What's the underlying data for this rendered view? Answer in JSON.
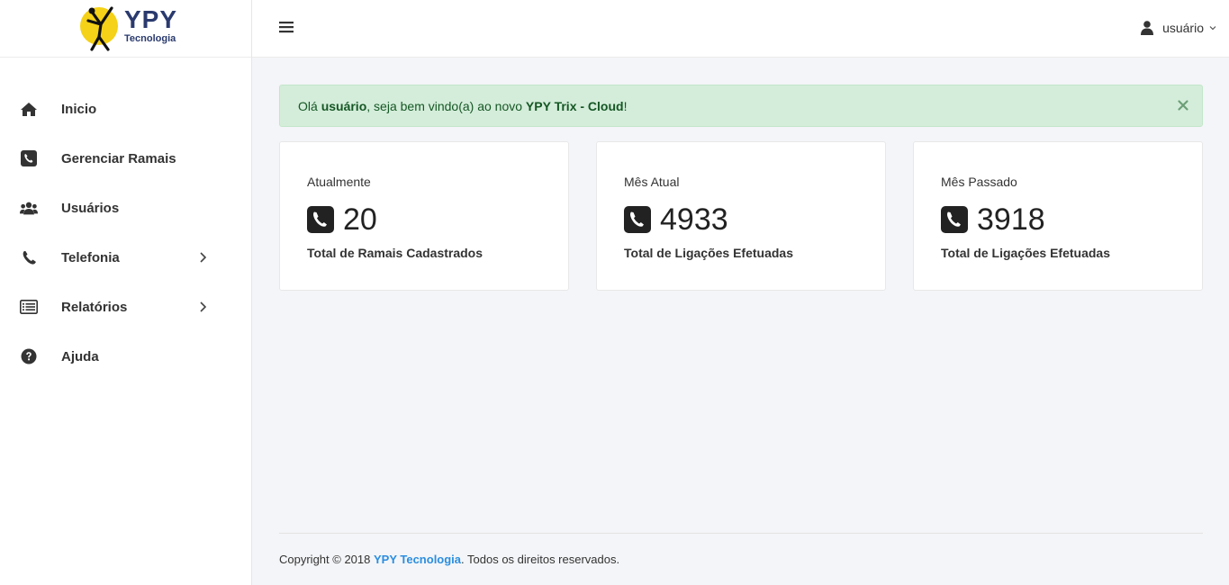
{
  "brand": {
    "name": "YPY",
    "subtitle": "Tecnologia"
  },
  "colors": {
    "accent": "#2b8ee0",
    "alert_bg": "#d4edda",
    "alert_text": "#155724",
    "logo_sun": "#f5d117",
    "logo_text": "#2a3a6e"
  },
  "sidebar": {
    "items": [
      {
        "label": "Inicio",
        "icon": "home-icon"
      },
      {
        "label": "Gerenciar Ramais",
        "icon": "phone-square-icon"
      },
      {
        "label": "Usuários",
        "icon": "users-icon"
      },
      {
        "label": "Telefonia",
        "icon": "phone-icon",
        "submenu": true
      },
      {
        "label": "Relatórios",
        "icon": "list-icon",
        "submenu": true
      },
      {
        "label": "Ajuda",
        "icon": "question-circle-icon"
      }
    ]
  },
  "topbar": {
    "menu_icon": "hamburger-icon",
    "user_name": "usuário"
  },
  "alert": {
    "greeting": "Olá ",
    "user": "usuário",
    "middle": ", seja bem vindo(a) ao novo ",
    "product": "YPY Trix - Cloud",
    "end": "!",
    "close": "×"
  },
  "cards": [
    {
      "title": "Atualmente",
      "value": "20",
      "description": "Total de Ramais Cadastrados"
    },
    {
      "title": "Mês Atual",
      "value": "4933",
      "description": "Total de Ligações Efetuadas"
    },
    {
      "title": "Mês Passado",
      "value": "3918",
      "description": "Total de Ligações Efetuadas"
    }
  ],
  "footer": {
    "prefix": "Copyright © 2018 ",
    "brand": "YPY Tecnologia",
    "suffix": ". Todos os direitos reservados."
  }
}
